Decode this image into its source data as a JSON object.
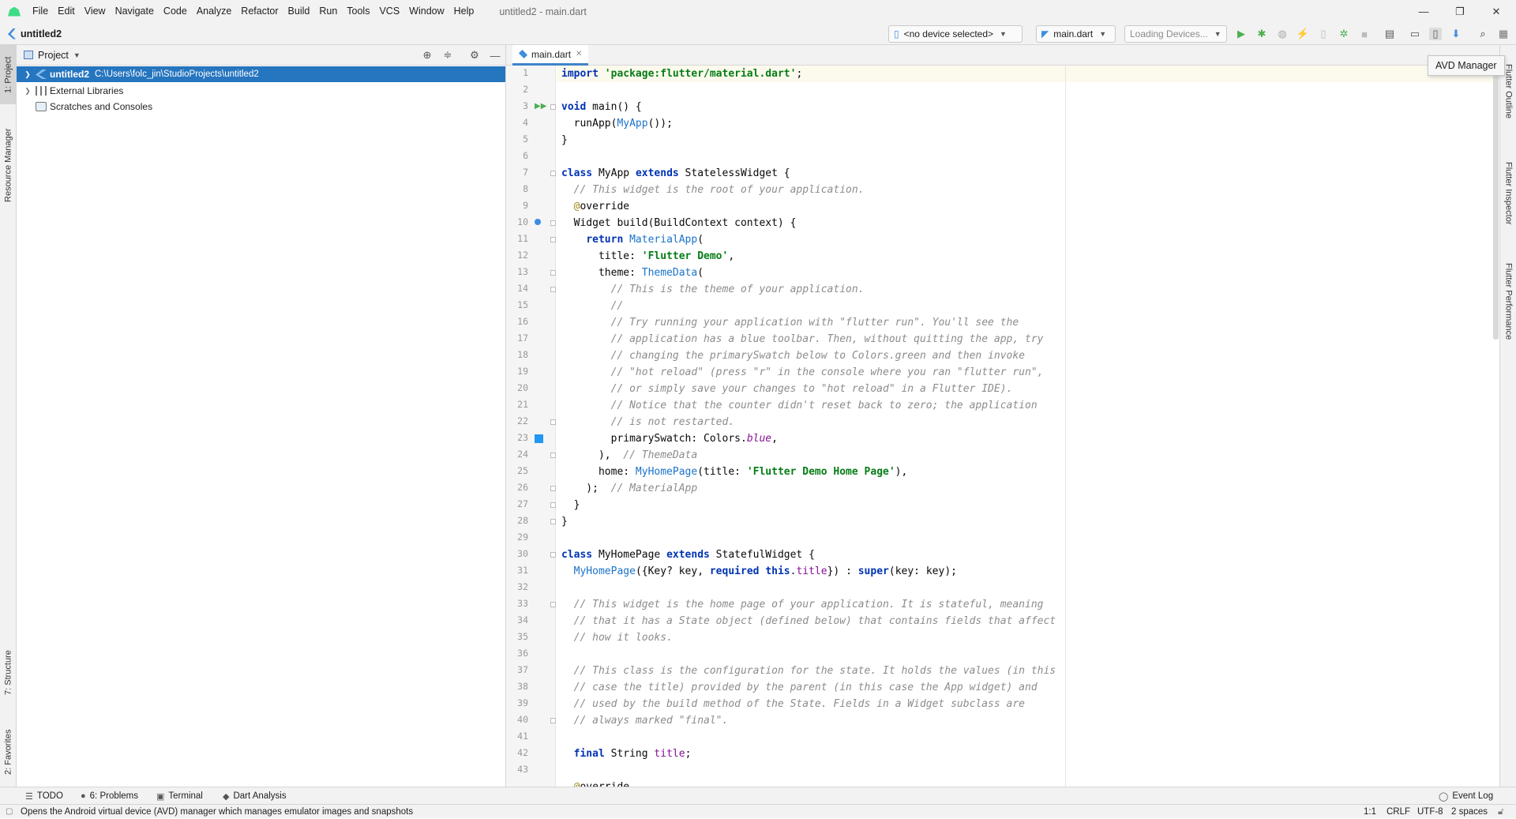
{
  "window": {
    "title": "untitled2 - main.dart",
    "minimize": "—",
    "restore": "❐",
    "close": "✕"
  },
  "menu": {
    "items": [
      "File",
      "Edit",
      "View",
      "Navigate",
      "Code",
      "Analyze",
      "Refactor",
      "Build",
      "Run",
      "Tools",
      "VCS",
      "Window",
      "Help"
    ]
  },
  "navbar": {
    "project_name": "untitled2",
    "device_selector": "<no device selected>",
    "run_config": "main.dart",
    "loading_devices": "Loading Devices..."
  },
  "left_tool_tabs": {
    "project": "1: Project",
    "resource_manager": "Resource Manager",
    "structure": "7: Structure",
    "favorites": "2: Favorites"
  },
  "right_tool_tabs": {
    "flutter_outline": "Flutter Outline",
    "flutter_inspector": "Flutter Inspector",
    "flutter_performance": "Flutter Performance"
  },
  "project_panel": {
    "title": "Project",
    "tree": [
      {
        "label": "untitled2",
        "path": "C:\\Users\\folc_jin\\StudioProjects\\untitled2",
        "selected": true
      },
      {
        "label": "External Libraries"
      },
      {
        "label": "Scratches and Consoles"
      }
    ]
  },
  "editor": {
    "tab": "main.dart",
    "line_numbers": [
      "1",
      "2",
      "3",
      "4",
      "5",
      "6",
      "7",
      "8",
      "9",
      "10",
      "11",
      "12",
      "13",
      "14",
      "15",
      "16",
      "17",
      "18",
      "19",
      "20",
      "21",
      "22",
      "23",
      "24",
      "25",
      "26",
      "27",
      "28",
      "29",
      "30",
      "31",
      "32",
      "33",
      "34",
      "35",
      "36",
      "37",
      "38",
      "39",
      "40",
      "41",
      "42",
      "43"
    ],
    "code": [
      "import 'package:flutter/material.dart';",
      "",
      "void main() {",
      "  runApp(MyApp());",
      "}",
      "",
      "class MyApp extends StatelessWidget {",
      "  // This widget is the root of your application.",
      "  @override",
      "  Widget build(BuildContext context) {",
      "    return MaterialApp(",
      "      title: 'Flutter Demo',",
      "      theme: ThemeData(",
      "        // This is the theme of your application.",
      "        //",
      "        // Try running your application with \"flutter run\". You'll see the",
      "        // application has a blue toolbar. Then, without quitting the app, try",
      "        // changing the primarySwatch below to Colors.green and then invoke",
      "        // \"hot reload\" (press \"r\" in the console where you ran \"flutter run\",",
      "        // or simply save your changes to \"hot reload\" in a Flutter IDE).",
      "        // Notice that the counter didn't reset back to zero; the application",
      "        // is not restarted.",
      "        primarySwatch: Colors.blue,",
      "      ),  // ThemeData",
      "      home: MyHomePage(title: 'Flutter Demo Home Page'),",
      "    );  // MaterialApp",
      "  }",
      "}",
      "",
      "class MyHomePage extends StatefulWidget {",
      "  MyHomePage({Key? key, required this.title}) : super(key: key);",
      "",
      "  // This widget is the home page of your application. It is stateful, meaning",
      "  // that it has a State object (defined below) that contains fields that affect",
      "  // how it looks.",
      "",
      "  // This class is the configuration for the state. It holds the values (in this",
      "  // case the title) provided by the parent (in this case the App widget) and",
      "  // used by the build method of the State. Fields in a Widget subclass are",
      "  // always marked \"final\".",
      "",
      "  final String title;",
      "",
      "  @override"
    ]
  },
  "tooltip": "AVD Manager",
  "bottom_tools": {
    "todo": "TODO",
    "problems": "6: Problems",
    "terminal": "Terminal",
    "dart_analysis": "Dart Analysis",
    "event_log": "Event Log"
  },
  "status": {
    "message": "Opens the Android virtual device (AVD) manager which manages emulator images and snapshots",
    "position": "1:1",
    "line_sep": "CRLF",
    "encoding": "UTF-8",
    "indent": "2 spaces"
  }
}
